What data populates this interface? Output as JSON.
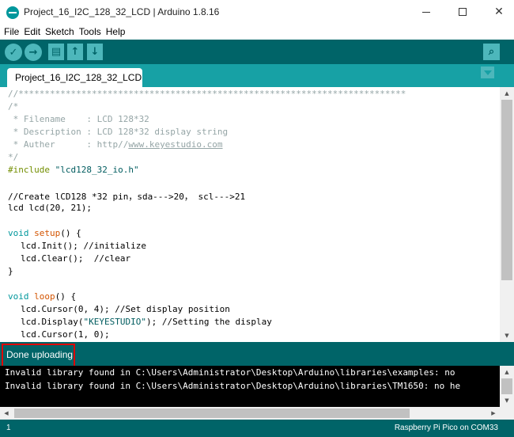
{
  "window": {
    "title": "Project_16_I2C_128_32_LCD | Arduino 1.8.16",
    "minimize_glyph": "—",
    "close_glyph": "✕"
  },
  "menu": [
    {
      "label": "File"
    },
    {
      "label": "Edit"
    },
    {
      "label": "Sketch"
    },
    {
      "label": "Tools"
    },
    {
      "label": "Help"
    }
  ],
  "toolbar": {
    "verify_icon": "✓",
    "upload_icon": "→",
    "new_icon": "▤",
    "open_icon": "↑",
    "save_icon": "↓",
    "serial_icon": "⌕"
  },
  "tabs": [
    {
      "label": "Project_16_I2C_128_32_LCD"
    }
  ],
  "editor": {
    "lines": [
      "//**************************************************************************",
      "/*",
      " * Filename    : LCD 128*32",
      " * Description : LCD 128*32 display string",
      " * Auther      : http//",
      "www.keyestudio.com",
      "*/",
      "#include",
      "\"lcd128_32_io.h\"",
      "//Create lCD128 *32 pin，sda--->20， scl--->21",
      "lcd lcd(20, 21);",
      "void",
      "setup",
      "() {",
      "lcd",
      ".Init(); //initialize",
      ".Clear();  //clear",
      "}",
      "loop",
      ".Cursor(0, 4); //Set display position",
      ".Display(",
      "\"KEYESTUDIO\"",
      "); //Setting the display",
      ".Cursor(1, 0);"
    ]
  },
  "status": {
    "message": "Done uploading."
  },
  "console": {
    "lines": [
      "Invalid library found in C:\\Users\\Administrator\\Desktop\\Arduino\\libraries\\examples: no",
      "Invalid library found in C:\\Users\\Administrator\\Desktop\\Arduino\\libraries\\TM1650: no he"
    ]
  },
  "footer": {
    "line_number": "1",
    "board": "Raspberry Pi Pico on COM33"
  },
  "colors": {
    "teal_dark": "#006468",
    "teal": "#17a1a5",
    "teal_button": "#4db7bb",
    "highlight": "#e00000"
  }
}
